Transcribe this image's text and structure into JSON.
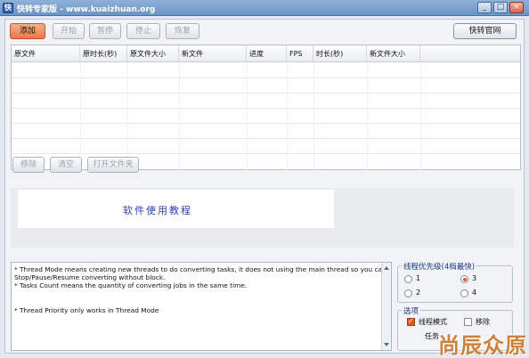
{
  "window": {
    "title": "快转专家版 - www.kuaizhuan.org",
    "controls": [
      "_",
      "□",
      "×"
    ]
  },
  "toolbar": {
    "add": "添加",
    "start": "开始",
    "pause": "暂停",
    "stop": "停止",
    "resume": "恢复",
    "website": "快转官网"
  },
  "table": {
    "columns": [
      "原文件",
      "原时长(秒)",
      "原文件大小",
      "新文件",
      "进度",
      "FPS",
      "时长(秒)",
      "新文件大小"
    ],
    "rows": []
  },
  "table_actions": {
    "remove": "移除",
    "clear": "清空",
    "open_folder": "打开文件夹"
  },
  "banner": {
    "text": "软件使用教程"
  },
  "info": {
    "lines": [
      "* Thread Mode means creating new threads to do converting tasks, it does not using the main thread so you can",
      "Stop/Pause/Resume converting without block.",
      "* Tasks Count means the quantity of converting jobs in the same time.",
      "* Thread Priority only works in Thread Mode"
    ]
  },
  "priority": {
    "title": "线程优先级(4档最快)",
    "options": [
      "1",
      "2",
      "3",
      "4"
    ],
    "selected": "3"
  },
  "options": {
    "title": "选项",
    "thread_mode": "线程模式",
    "thread_mode_checked": true,
    "remove_label": "移除",
    "remove_checked": false,
    "tasks_label": "任务"
  },
  "watermark": "尚辰众原",
  "colors": {
    "accent": "#e9774a",
    "title_bar": "#7aa0cf",
    "banner_text": "#2d3fb0",
    "watermark": "#c97a2a"
  }
}
